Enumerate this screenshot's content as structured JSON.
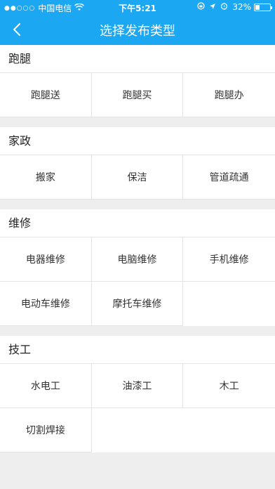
{
  "status_bar": {
    "signal": "●●○○○",
    "carrier": "中国电信",
    "time": "下午5:21",
    "battery": "32%",
    "battery_level": 0.32
  },
  "nav": {
    "title": "选择发布类型"
  },
  "sections": [
    {
      "title": "跑腿",
      "items": [
        "跑腿送",
        "跑腿买",
        "跑腿办"
      ]
    },
    {
      "title": "家政",
      "items": [
        "搬家",
        "保洁",
        "管道疏通"
      ]
    },
    {
      "title": "维修",
      "items": [
        "电器维修",
        "电脑维修",
        "手机维修",
        "电动车维修",
        "摩托车维修"
      ]
    },
    {
      "title": "技工",
      "items": [
        "水电工",
        "油漆工",
        "木工",
        "切割焊接"
      ]
    }
  ],
  "colors": {
    "accent": "#1ba7f2",
    "background": "#eeeeee"
  }
}
